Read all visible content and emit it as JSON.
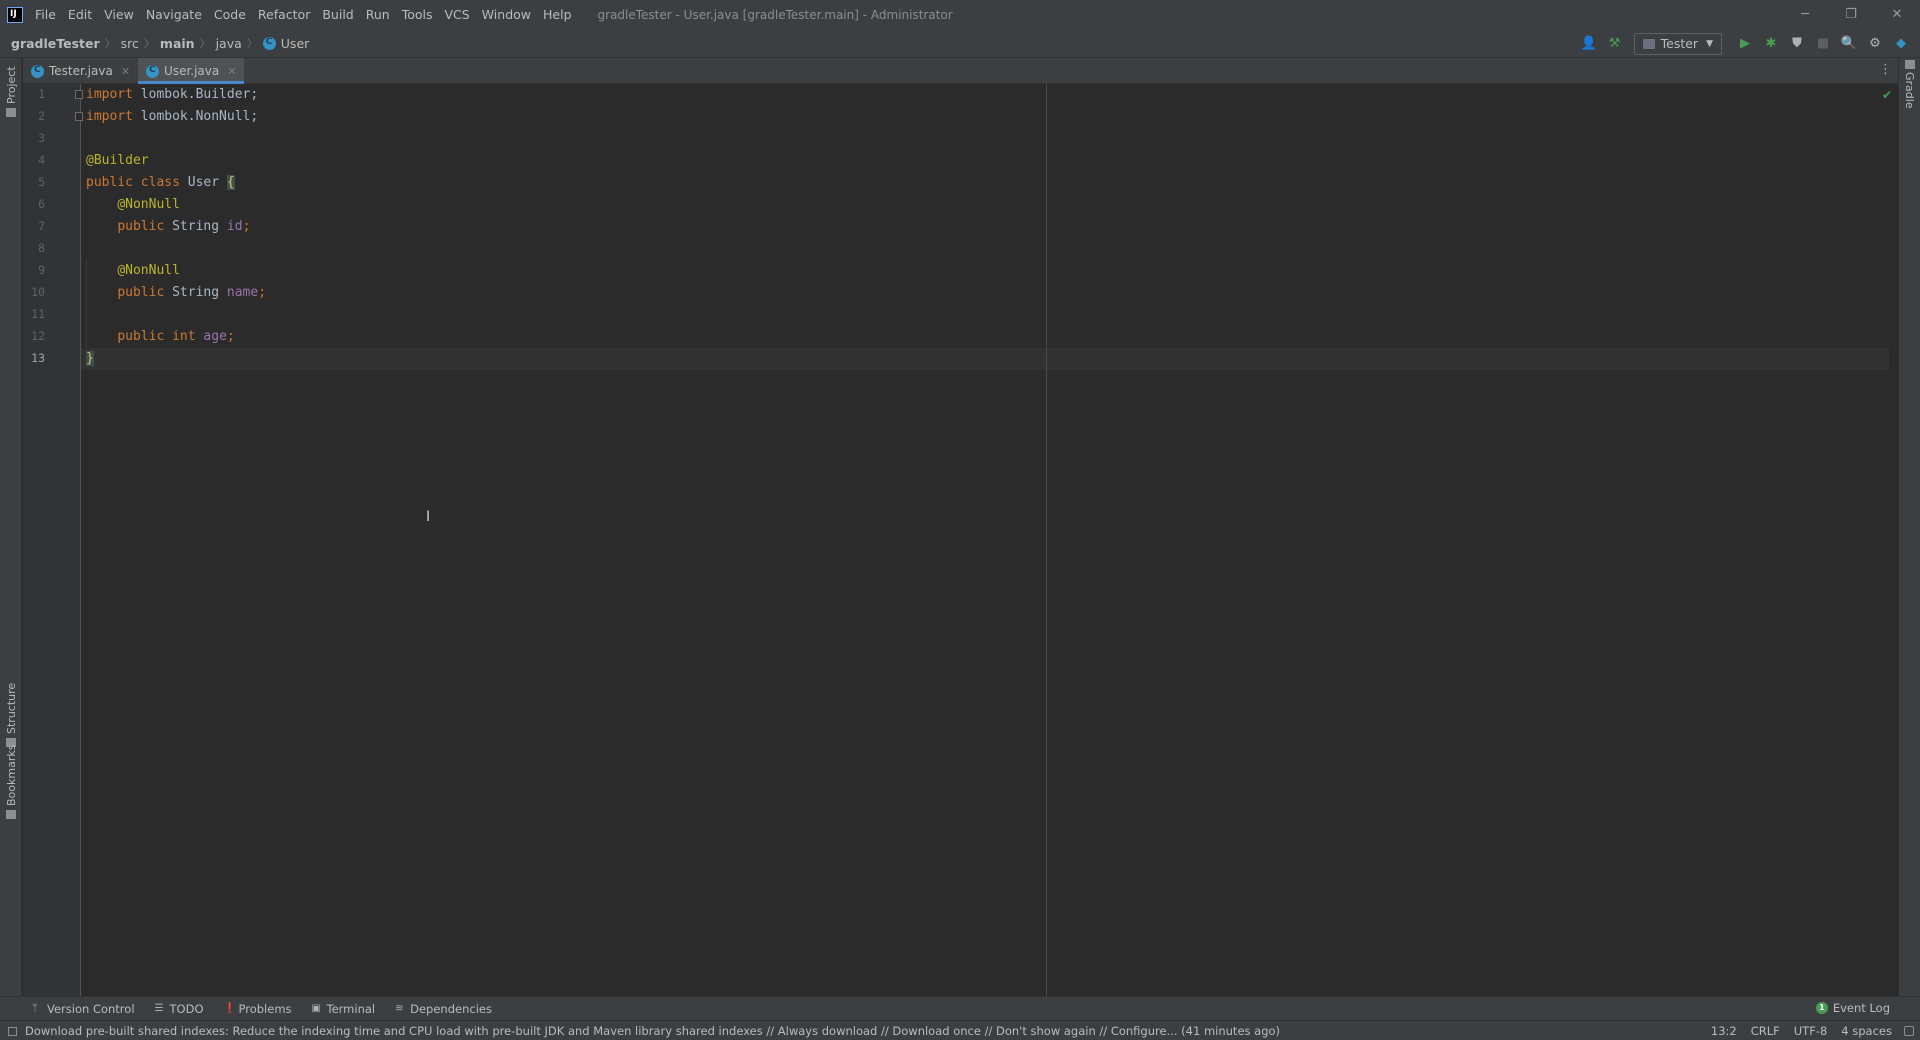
{
  "window": {
    "title": "gradleTester - User.java [gradleTester.main] - Administrator",
    "controls": {
      "minimize": "─",
      "restore": "❐",
      "close": "✕"
    }
  },
  "menu": [
    "File",
    "Edit",
    "View",
    "Navigate",
    "Code",
    "Refactor",
    "Build",
    "Run",
    "Tools",
    "VCS",
    "Window",
    "Help"
  ],
  "breadcrumbs": [
    "gradleTester",
    "src",
    "main",
    "java",
    "User"
  ],
  "toolbar": {
    "run_config": "Tester"
  },
  "tool_stripes": {
    "left_top": "Project",
    "left_structure": "Structure",
    "left_bookmarks": "Bookmarks",
    "right": "Gradle"
  },
  "tabs": [
    {
      "label": "Tester.java",
      "active": false
    },
    {
      "label": "User.java",
      "active": true
    }
  ],
  "editor": {
    "line_numbers": [
      "1",
      "2",
      "3",
      "4",
      "5",
      "6",
      "7",
      "8",
      "9",
      "10",
      "11",
      "12",
      "13"
    ],
    "current_line": "13",
    "lines": [
      [
        {
          "t": "import",
          "c": "kw"
        },
        {
          "t": " lombok.Builder;",
          "c": ""
        }
      ],
      [
        {
          "t": "import",
          "c": "kw"
        },
        {
          "t": " lombok.NonNull;",
          "c": ""
        }
      ],
      [],
      [
        {
          "t": "@Builder",
          "c": "ann"
        }
      ],
      [
        {
          "t": "public class",
          "c": "kw"
        },
        {
          "t": " User ",
          "c": ""
        },
        {
          "t": "{",
          "c": "brace"
        }
      ],
      [
        {
          "t": "    ",
          "c": ""
        },
        {
          "t": "@NonNull",
          "c": "ann"
        }
      ],
      [
        {
          "t": "    ",
          "c": ""
        },
        {
          "t": "public",
          "c": "kw"
        },
        {
          "t": " String ",
          "c": ""
        },
        {
          "t": "id",
          "c": "field"
        },
        {
          "t": ";",
          "c": "kw"
        }
      ],
      [],
      [
        {
          "t": "    ",
          "c": ""
        },
        {
          "t": "@NonNull",
          "c": "ann"
        }
      ],
      [
        {
          "t": "    ",
          "c": ""
        },
        {
          "t": "public",
          "c": "kw"
        },
        {
          "t": " String ",
          "c": ""
        },
        {
          "t": "name",
          "c": "field"
        },
        {
          "t": ";",
          "c": "kw"
        }
      ],
      [],
      [
        {
          "t": "    ",
          "c": ""
        },
        {
          "t": "public int",
          "c": "kw"
        },
        {
          "t": " ",
          "c": ""
        },
        {
          "t": "age",
          "c": "field"
        },
        {
          "t": ";",
          "c": "kw"
        }
      ],
      [
        {
          "t": "}",
          "c": "brace"
        }
      ]
    ]
  },
  "bottom_tools": [
    "Version Control",
    "TODO",
    "Problems",
    "Terminal",
    "Dependencies"
  ],
  "event_log": "Event Log",
  "event_log_badge": "1",
  "status": {
    "message": "Download pre-built shared indexes: Reduce the indexing time and CPU load with pre-built JDK and Maven library shared indexes // Always download // Download once // Don't show again // Configure... (41 minutes ago)",
    "position": "13:2",
    "line_sep": "CRLF",
    "encoding": "UTF-8",
    "indent": "4 spaces"
  },
  "colors": {
    "keyword": "#cc7832",
    "annotation": "#bbb529",
    "field": "#9876aa",
    "text": "#a9b7c6",
    "accent": "#4a88c7",
    "ok": "#499c54"
  }
}
